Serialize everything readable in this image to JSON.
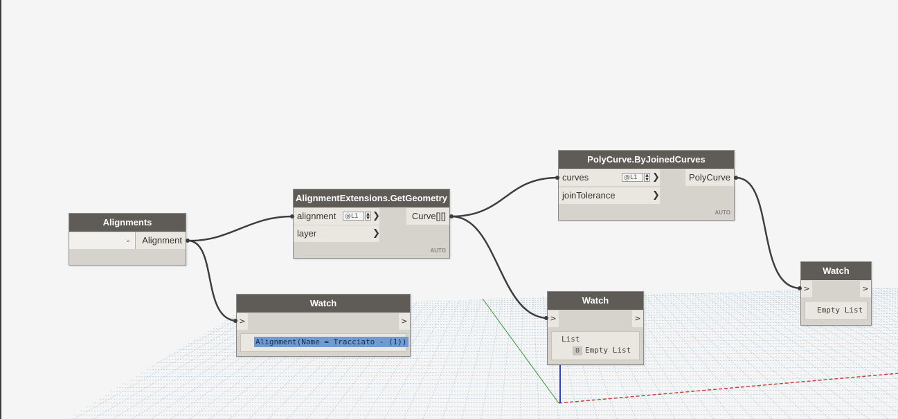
{
  "nodes": {
    "alignments": {
      "title": "Alignments",
      "dropdown_icon": "chevron-down-icon",
      "dropdown_glyph": "⌄",
      "output": "Alignment"
    },
    "get_geometry": {
      "title": "AlignmentExtensions.GetGeometry",
      "inputs": [
        {
          "label": "alignment",
          "lacing": "@L1"
        },
        {
          "label": "layer"
        }
      ],
      "output": "Curve[][]",
      "auto": "AUTO"
    },
    "polycurve": {
      "title": "PolyCurve.ByJoinedCurves",
      "inputs": [
        {
          "label": "curves",
          "lacing": "@L1"
        },
        {
          "label": "joinTolerance"
        }
      ],
      "output": "PolyCurve",
      "auto": "AUTO"
    },
    "watch1": {
      "title": "Watch",
      "port_in": ">",
      "port_out": ">",
      "value": "Alignment(Name = Tracciato - (1))"
    },
    "watch2": {
      "title": "Watch",
      "port_in": ">",
      "port_out": ">",
      "list_label": "List",
      "index": "0",
      "value": "Empty List"
    },
    "watch3": {
      "title": "Watch",
      "port_in": ">",
      "port_out": ">",
      "value": "Empty List"
    }
  },
  "glyphs": {
    "port_arrow": "❯",
    "spin_up": "▲",
    "spin_down": "▼"
  },
  "colors": {
    "node_header": "#5f5c58",
    "node_body": "#d6d3cd",
    "wire": "#3e3e3e",
    "selection": "#6f9bd1",
    "grid": "#b7cfe0",
    "axis_x": "#d23a3a",
    "axis_y": "#2f9a2f",
    "axis_z": "#2a3fbf"
  }
}
